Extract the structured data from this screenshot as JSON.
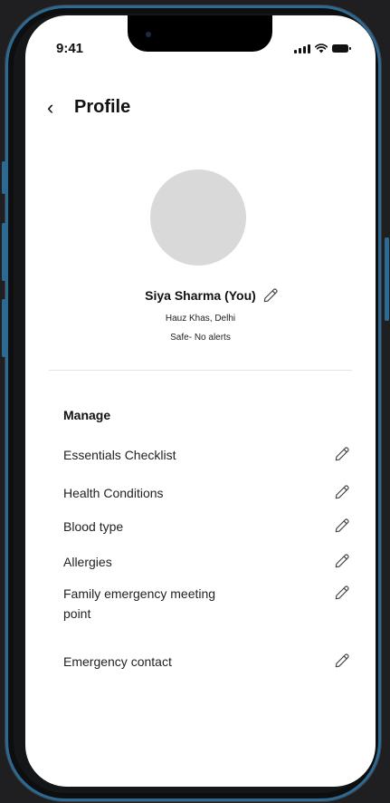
{
  "status_bar": {
    "time": "9:41"
  },
  "header": {
    "title": "Profile"
  },
  "profile": {
    "name": "Siya Sharma (You)",
    "location": "Hauz Khas, Delhi",
    "status": "Safe- No alerts"
  },
  "manage": {
    "title": "Manage",
    "items": [
      {
        "label": "Essentials Checklist"
      },
      {
        "label": "Health Conditions"
      },
      {
        "label": "Blood type"
      },
      {
        "label": "Allergies"
      },
      {
        "label": "Family emergency meeting point"
      },
      {
        "label": "Emergency contact"
      }
    ]
  },
  "icons": {
    "back": "chevron-left-icon",
    "edit": "pencil-icon",
    "signal": "cellular-signal-icon",
    "wifi": "wifi-icon",
    "battery": "battery-icon"
  },
  "colors": {
    "frame": "#2d6a93",
    "background": "#1f1f21",
    "avatar_placeholder": "#d9d9d9"
  }
}
